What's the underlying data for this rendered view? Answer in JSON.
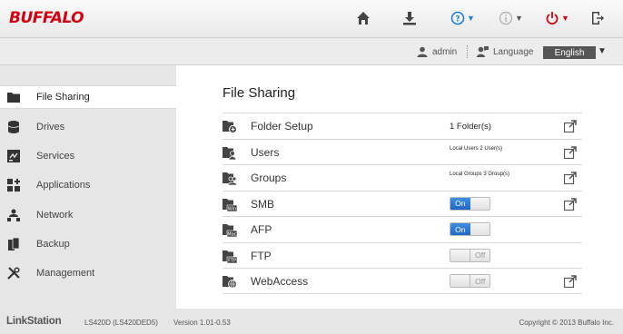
{
  "header": {
    "logo": "BUFFALO",
    "icons": [
      "home-icon",
      "download-icon",
      "help-icon",
      "info-icon",
      "power-icon",
      "logout-icon"
    ],
    "colors": {
      "accent_blue": "#1e7fd6",
      "brand_red": "#d5000f",
      "info_gray": "#b5b5b5"
    }
  },
  "userbar": {
    "username": "admin",
    "language_label": "Language",
    "language_value": "English"
  },
  "sidebar": {
    "items": [
      {
        "label": "File Sharing",
        "icon": "folder-icon",
        "active": true
      },
      {
        "label": "Drives",
        "icon": "database-icon"
      },
      {
        "label": "Services",
        "icon": "services-icon"
      },
      {
        "label": "Applications",
        "icon": "applications-icon"
      },
      {
        "label": "Network",
        "icon": "network-icon"
      },
      {
        "label": "Backup",
        "icon": "backup-icon"
      },
      {
        "label": "Management",
        "icon": "tools-icon"
      }
    ]
  },
  "main": {
    "title": "File Sharing",
    "rows": [
      {
        "label": "Folder Setup",
        "icon": "folder-add-icon",
        "value": "1 Folder(s)",
        "link": true
      },
      {
        "label": "Users",
        "icon": "user-folder-icon",
        "value": "Local Users 2 User(s)",
        "link": true
      },
      {
        "label": "Groups",
        "icon": "group-folder-icon",
        "value": "Local Groups 3 Group(s)",
        "link": true
      },
      {
        "label": "SMB",
        "icon": "win-folder-icon",
        "toggle": "On",
        "link": true
      },
      {
        "label": "AFP",
        "icon": "mac-folder-icon",
        "toggle": "On",
        "link": false
      },
      {
        "label": "FTP",
        "icon": "ftp-folder-icon",
        "toggle": "Off",
        "link": false
      },
      {
        "label": "WebAccess",
        "icon": "web-folder-icon",
        "toggle": "Off",
        "link": true
      }
    ]
  },
  "footer": {
    "brand": "LinkStation",
    "model": "LS420D (LS420DED5)",
    "version": "Version 1.01-0.53",
    "copyright": "Copyright © 2013 Buffalo Inc."
  }
}
